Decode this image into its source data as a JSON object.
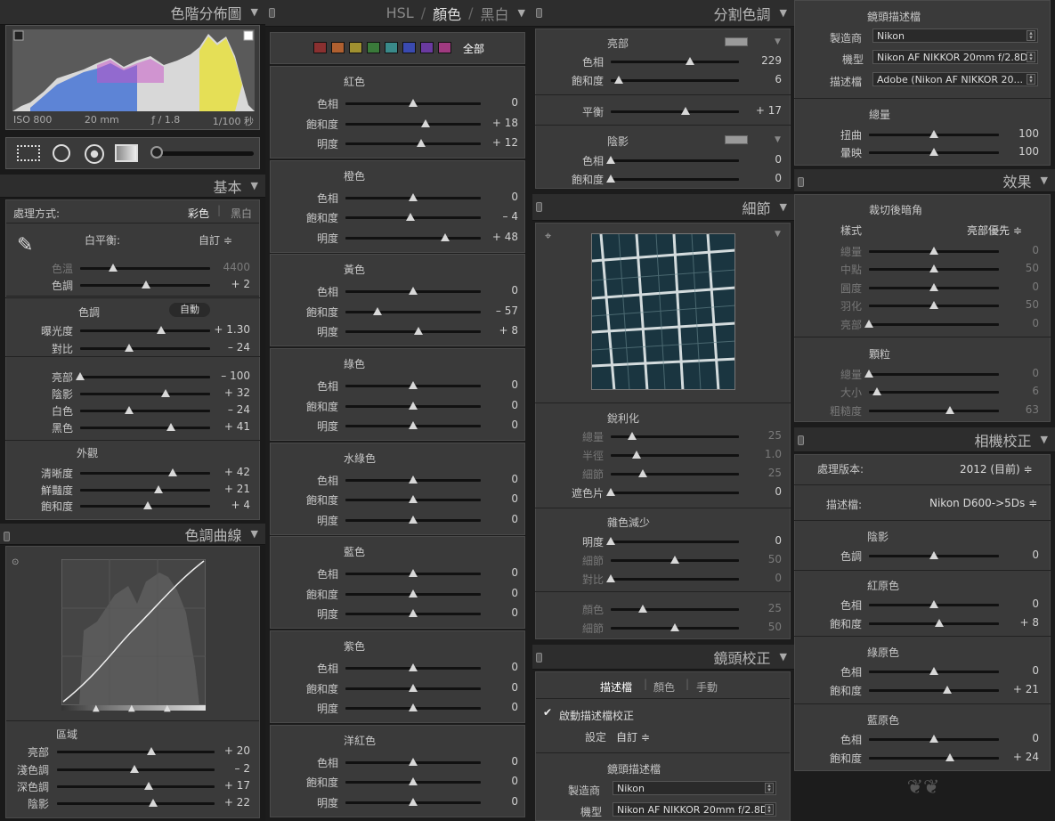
{
  "left": {
    "histogram": {
      "title": "色階分佈圖",
      "iso": "ISO 800",
      "focal": "20 mm",
      "aperture": "ƒ / 1.8",
      "shutter": "1/100 秒"
    },
    "basic": {
      "title": "基本",
      "treatment_label": "處理方式:",
      "treatment_color": "彩色",
      "treatment_bw": "黑白",
      "wb_label": "白平衡:",
      "wb_value": "自訂 ≑",
      "temp": {
        "label": "色溫",
        "value": "4400",
        "pos": 0.25
      },
      "tint": {
        "label": "色調",
        "value": "+ 2",
        "pos": 0.51
      },
      "tone_label": "色調",
      "auto_label": "自動",
      "exposure": {
        "label": "曝光度",
        "value": "+ 1.30",
        "pos": 0.62
      },
      "contrast": {
        "label": "對比",
        "value": "– 24",
        "pos": 0.38
      },
      "highlights": {
        "label": "亮部",
        "value": "– 100",
        "pos": 0.0
      },
      "shadows": {
        "label": "陰影",
        "value": "+ 32",
        "pos": 0.66
      },
      "whites": {
        "label": "白色",
        "value": "– 24",
        "pos": 0.38
      },
      "blacks": {
        "label": "黑色",
        "value": "+ 41",
        "pos": 0.7
      },
      "presence_label": "外觀",
      "clarity": {
        "label": "清晰度",
        "value": "+ 42",
        "pos": 0.71
      },
      "vibrance": {
        "label": "鮮豔度",
        "value": "+ 21",
        "pos": 0.6
      },
      "saturation": {
        "label": "飽和度",
        "value": "+ 4",
        "pos": 0.52
      }
    },
    "tonecurve": {
      "title": "色調曲線",
      "region_label": "區域",
      "highlights": {
        "label": "亮部",
        "value": "+ 20",
        "pos": 0.6
      },
      "lights": {
        "label": "淺色調",
        "value": "– 2",
        "pos": 0.49
      },
      "darks": {
        "label": "深色調",
        "value": "+ 17",
        "pos": 0.58
      },
      "shadows": {
        "label": "陰影",
        "value": "+ 22",
        "pos": 0.61
      }
    }
  },
  "hsl": {
    "tab_hsl": "HSL",
    "sep": "/",
    "tab_color": "顏色",
    "tab_bw": "黑白",
    "all_label": "全部",
    "swatches": [
      "#8a3030",
      "#b06030",
      "#a09030",
      "#3a7a3a",
      "#3a8a8a",
      "#3a4ab0",
      "#6a3aa0",
      "#a03a80"
    ],
    "groups": [
      {
        "name": "紅色",
        "rows": [
          {
            "label": "色相",
            "value": "0",
            "pos": 0.5
          },
          {
            "label": "飽和度",
            "value": "+ 18",
            "pos": 0.59
          },
          {
            "label": "明度",
            "value": "+ 12",
            "pos": 0.56
          }
        ]
      },
      {
        "name": "橙色",
        "rows": [
          {
            "label": "色相",
            "value": "0",
            "pos": 0.5
          },
          {
            "label": "飽和度",
            "value": "– 4",
            "pos": 0.48
          },
          {
            "label": "明度",
            "value": "+ 48",
            "pos": 0.74
          }
        ]
      },
      {
        "name": "黃色",
        "rows": [
          {
            "label": "色相",
            "value": "0",
            "pos": 0.5
          },
          {
            "label": "飽和度",
            "value": "– 57",
            "pos": 0.24
          },
          {
            "label": "明度",
            "value": "+ 8",
            "pos": 0.54
          }
        ]
      },
      {
        "name": "綠色",
        "rows": [
          {
            "label": "色相",
            "value": "0",
            "pos": 0.5
          },
          {
            "label": "飽和度",
            "value": "0",
            "pos": 0.5
          },
          {
            "label": "明度",
            "value": "0",
            "pos": 0.5
          }
        ]
      },
      {
        "name": "水綠色",
        "rows": [
          {
            "label": "色相",
            "value": "0",
            "pos": 0.5
          },
          {
            "label": "飽和度",
            "value": "0",
            "pos": 0.5
          },
          {
            "label": "明度",
            "value": "0",
            "pos": 0.5
          }
        ]
      },
      {
        "name": "藍色",
        "rows": [
          {
            "label": "色相",
            "value": "0",
            "pos": 0.5
          },
          {
            "label": "飽和度",
            "value": "0",
            "pos": 0.5
          },
          {
            "label": "明度",
            "value": "0",
            "pos": 0.5
          }
        ]
      },
      {
        "name": "紫色",
        "rows": [
          {
            "label": "色相",
            "value": "0",
            "pos": 0.5
          },
          {
            "label": "飽和度",
            "value": "0",
            "pos": 0.5
          },
          {
            "label": "明度",
            "value": "0",
            "pos": 0.5
          }
        ]
      },
      {
        "name": "洋紅色",
        "rows": [
          {
            "label": "色相",
            "value": "0",
            "pos": 0.5
          },
          {
            "label": "飽和度",
            "value": "0",
            "pos": 0.5
          },
          {
            "label": "明度",
            "value": "0",
            "pos": 0.5
          }
        ]
      }
    ]
  },
  "split": {
    "title": "分割色調",
    "highlights_label": "亮部",
    "hl_hue": {
      "label": "色相",
      "value": "229",
      "pos": 0.62
    },
    "hl_sat": {
      "label": "飽和度",
      "value": "6",
      "pos": 0.06
    },
    "balance": {
      "label": "平衡",
      "value": "+ 17",
      "pos": 0.58
    },
    "shadows_label": "陰影",
    "sh_hue": {
      "label": "色相",
      "value": "0",
      "pos": 0.0
    },
    "sh_sat": {
      "label": "飽和度",
      "value": "0",
      "pos": 0.0
    }
  },
  "detail": {
    "title": "細節",
    "sharpen_label": "銳利化",
    "amount": {
      "label": "總量",
      "value": "25",
      "pos": 0.17
    },
    "radius": {
      "label": "半徑",
      "value": "1.0",
      "pos": 0.2
    },
    "detail": {
      "label": "細節",
      "value": "25",
      "pos": 0.25
    },
    "masking": {
      "label": "遮色片",
      "value": "0",
      "pos": 0.0
    },
    "nr_label": "雜色減少",
    "lum": {
      "label": "明度",
      "value": "0",
      "pos": 0.0
    },
    "lum_detail": {
      "label": "細節",
      "value": "50",
      "pos": 0.5
    },
    "lum_contrast": {
      "label": "對比",
      "value": "0",
      "pos": 0.0
    },
    "color": {
      "label": "顏色",
      "value": "25",
      "pos": 0.25
    },
    "color_detail": {
      "label": "細節",
      "value": "50",
      "pos": 0.5
    }
  },
  "lens": {
    "title": "鏡頭校正",
    "tab_profile": "描述檔",
    "tab_color": "顏色",
    "tab_manual": "手動",
    "enable_label": "啟動描述檔校正",
    "setup_label": "設定",
    "setup_value": "自訂 ≑",
    "profile_label": "鏡頭描述檔",
    "make_label": "製造商",
    "make_value": "Nikon",
    "model_label": "機型",
    "model_value": "Nikon AF NIKKOR 20mm f/2.8D"
  },
  "right": {
    "profile_label": "鏡頭描述檔",
    "make_label": "製造商",
    "make_value": "Nikon",
    "model_label": "機型",
    "model_value": "Nikon AF NIKKOR 20mm f/2.8D",
    "profile_field_label": "描述檔",
    "profile_value": "Adobe (Nikon AF NIKKOR 20...",
    "amount_label": "總量",
    "distortion": {
      "label": "扭曲",
      "value": "100",
      "pos": 0.5
    },
    "vignetting": {
      "label": "暈映",
      "value": "100",
      "pos": 0.5
    },
    "effects_title": "效果",
    "vignette_label": "裁切後暗角",
    "style_label": "樣式",
    "style_value": "亮部優先 ≑",
    "v_amount": {
      "label": "總量",
      "value": "0",
      "pos": 0.5
    },
    "v_mid": {
      "label": "中點",
      "value": "50",
      "pos": 0.5
    },
    "v_round": {
      "label": "圓度",
      "value": "0",
      "pos": 0.5
    },
    "v_feather": {
      "label": "羽化",
      "value": "50",
      "pos": 0.5
    },
    "v_high": {
      "label": "亮部",
      "value": "0",
      "pos": 0.0
    },
    "grain_label": "顆粒",
    "g_amount": {
      "label": "總量",
      "value": "0",
      "pos": 0.0
    },
    "g_size": {
      "label": "大小",
      "value": "6",
      "pos": 0.06
    },
    "g_rough": {
      "label": "粗糙度",
      "value": "63",
      "pos": 0.62
    },
    "cam_title": "相機校正",
    "process_label": "處理版本:",
    "process_value": "2012 (目前) ≑",
    "cprofile_label": "描述檔:",
    "cprofile_value": "Nikon D600->5Ds ≑",
    "shadows_label": "陰影",
    "sh_tint": {
      "label": "色調",
      "value": "0",
      "pos": 0.5
    },
    "red_label": "紅原色",
    "r_hue": {
      "label": "色相",
      "value": "0",
      "pos": 0.5
    },
    "r_sat": {
      "label": "飽和度",
      "value": "+ 8",
      "pos": 0.54
    },
    "green_label": "綠原色",
    "g_hue": {
      "label": "色相",
      "value": "0",
      "pos": 0.5
    },
    "g_sat": {
      "label": "飽和度",
      "value": "+ 21",
      "pos": 0.6
    },
    "blue_label": "藍原色",
    "b_hue": {
      "label": "色相",
      "value": "0",
      "pos": 0.5
    },
    "b_sat": {
      "label": "飽和度",
      "value": "+ 24",
      "pos": 0.62
    }
  }
}
